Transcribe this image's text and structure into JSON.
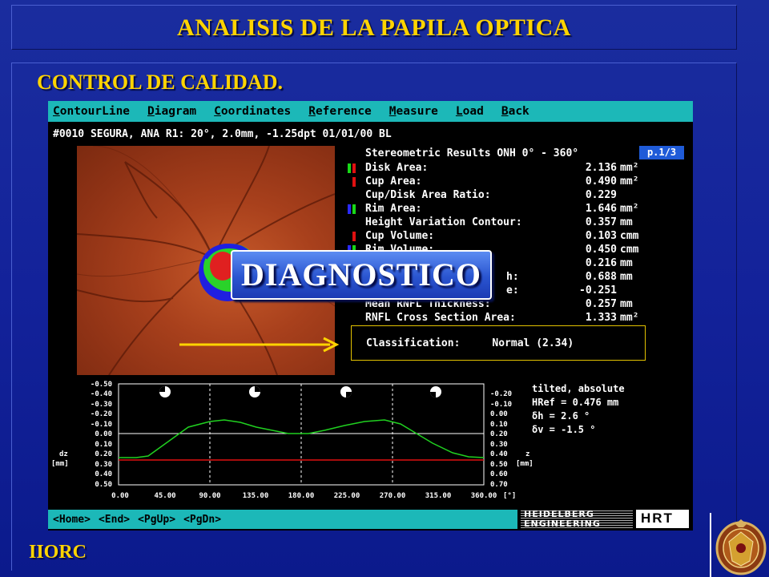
{
  "slide": {
    "title": "ANALISIS DE LA PAPILA OPTICA",
    "section": "CONTROL DE CALIDAD.",
    "footer": "IIORC",
    "accent_color": "#ffd400",
    "seal_icon": "university-seal-icon"
  },
  "hrt": {
    "menu": [
      {
        "first": "C",
        "rest": "ontourLine"
      },
      {
        "first": "D",
        "rest": "iagram"
      },
      {
        "first": "C",
        "rest": "oordinates"
      },
      {
        "first": "R",
        "rest": "eference"
      },
      {
        "first": "M",
        "rest": "easure"
      },
      {
        "first": "L",
        "rest": "oad"
      },
      {
        "first": "B",
        "rest": "ack"
      }
    ],
    "patient_line": "#0010 SEGURA, ANA  R1: 20°, 2.0mm, -1.25dpt 01/01/00 BL",
    "results_title": "Stereometric Results ONH 0° - 360°",
    "page_badge": "p.1/3",
    "results": [
      {
        "label": "Disk Area:",
        "value": "2.136",
        "unit": "mm²",
        "marker": "green-red"
      },
      {
        "label": "Cup Area:",
        "value": "0.490",
        "unit": "mm²",
        "marker": "red"
      },
      {
        "label": "Cup/Disk Area Ratio:",
        "value": "0.229",
        "unit": "",
        "marker": ""
      },
      {
        "label": "Rim Area:",
        "value": "1.646",
        "unit": "mm²",
        "marker": "blue-green"
      },
      {
        "label": "Height Variation Contour:",
        "value": "0.357",
        "unit": "mm",
        "marker": ""
      },
      {
        "label": "Cup Volume:",
        "value": "0.103",
        "unit": "cmm",
        "marker": "red"
      },
      {
        "label": "Rim Volume:",
        "value": "0.450",
        "unit": "cmm",
        "marker": "blue-green"
      },
      {
        "label": "",
        "value": "0.216",
        "unit": "mm",
        "marker": "blue-green"
      },
      {
        "label": "h:",
        "value": "0.688",
        "unit": "mm",
        "marker": ""
      },
      {
        "label": "e:",
        "value": "-0.251",
        "unit": "",
        "marker": ""
      },
      {
        "label": "Mean RNFL Thickness:",
        "value": "0.257",
        "unit": "mm",
        "marker": ""
      },
      {
        "label": "RNFL Cross Section Area:",
        "value": "1.333",
        "unit": "mm²",
        "marker": ""
      }
    ],
    "classification_label": "Classification:",
    "classification_value": "Normal  (2.34)",
    "diagnostic_label": "DIAGNOSTICO",
    "plot": {
      "left_axis": [
        "-0.50",
        "-0.40",
        "-0.30",
        "-0.20",
        "-0.10",
        "0.00",
        "0.10",
        "0.20",
        "0.30",
        "0.40",
        "0.50"
      ],
      "right_axis": [
        "-0.20",
        "-0.10",
        "0.00",
        "0.10",
        "0.20",
        "0.30",
        "0.40",
        "0.50",
        "0.60",
        "0.70"
      ],
      "x_axis": [
        "0.00",
        "45.00",
        "90.00",
        "135.00",
        "180.00",
        "225.00",
        "270.00",
        "315.00",
        "360.00"
      ],
      "x_unit": "[°]",
      "left_unit_1": "dz",
      "left_unit_2": "[mm]",
      "right_unit_1": "z",
      "right_unit_2": "[mm]",
      "info": [
        "tilted, absolute",
        "HRef = 0.476 mm",
        "δh  =   2.6 °",
        "δv  =  -1.5 °"
      ]
    },
    "footer_keys": [
      "<Home>",
      "<End>",
      "<PgUp>",
      "<PgDn>"
    ],
    "logo_line1": "HEIDELBERG",
    "logo_line2": "ENGINEERING",
    "logo_mark": "HRT"
  }
}
